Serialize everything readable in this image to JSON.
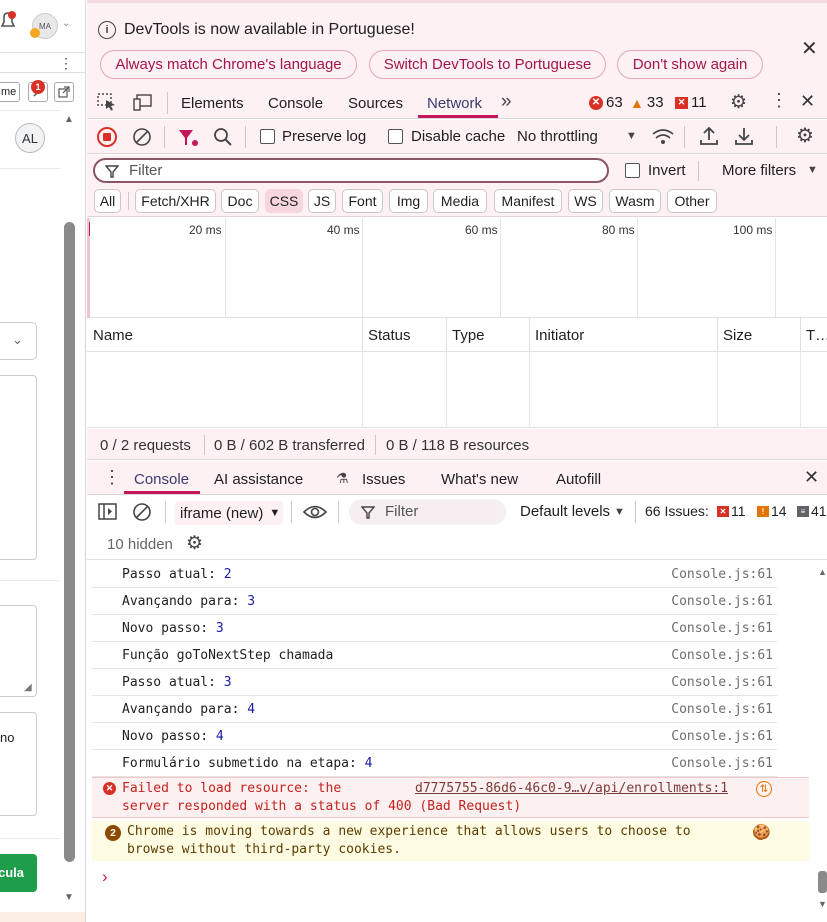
{
  "page_strip": {
    "avatar_initials": "MA",
    "notification_badge": "1",
    "user_initials": "AL",
    "tag_label": "me",
    "cut_text": "no",
    "action_button_label": "cula"
  },
  "infobar": {
    "message": "DevTools is now available in Portuguese!",
    "buttons": [
      "Always match Chrome's language",
      "Switch DevTools to Portuguese",
      "Don't show again"
    ]
  },
  "tabs": {
    "items": [
      "Elements",
      "Console",
      "Sources",
      "Network"
    ],
    "active": "Network",
    "errors": "63",
    "warnings": "33",
    "issues": "11"
  },
  "network_toolbar": {
    "preserve_log": "Preserve log",
    "disable_cache": "Disable cache",
    "throttling": "No throttling"
  },
  "filter_bar": {
    "placeholder": "Filter",
    "invert": "Invert",
    "more_filters": "More filters"
  },
  "type_filters": [
    "All",
    "Fetch/XHR",
    "Doc",
    "CSS",
    "JS",
    "Font",
    "Img",
    "Media",
    "Manifest",
    "WS",
    "Wasm",
    "Other"
  ],
  "active_type_filter": "CSS",
  "timeline": {
    "ticks": [
      "20 ms",
      "40 ms",
      "60 ms",
      "80 ms",
      "100 ms"
    ]
  },
  "table": {
    "columns": [
      "Name",
      "Status",
      "Type",
      "Initiator",
      "Size",
      "T…"
    ]
  },
  "summary": {
    "requests": "0 / 2 requests",
    "transferred": "0 B / 602 B transferred",
    "resources": "0 B / 118 B resources"
  },
  "drawer": {
    "tabs": [
      "Console",
      "AI assistance",
      "Issues",
      "What's new",
      "Autofill"
    ],
    "active": "Console"
  },
  "console_toolbar": {
    "context": "iframe (new)",
    "filter_placeholder": "Filter",
    "levels": "Default levels",
    "issues_label": "66 Issues:",
    "issue_errors": "11",
    "issue_warnings": "14",
    "issue_info": "41",
    "hidden": "10 hidden"
  },
  "console_messages": [
    {
      "text": "Passo atual: ",
      "num": "2",
      "source": "Console.js:61"
    },
    {
      "text": "Avançando para: ",
      "num": "3",
      "source": "Console.js:61"
    },
    {
      "text": "Novo passo: ",
      "num": "3",
      "source": "Console.js:61"
    },
    {
      "text": "Função goToNextStep chamada",
      "num": "",
      "source": "Console.js:61"
    },
    {
      "text": "Passo atual: ",
      "num": "3",
      "source": "Console.js:61"
    },
    {
      "text": "Avançando para: ",
      "num": "4",
      "source": "Console.js:61"
    },
    {
      "text": "Novo passo: ",
      "num": "4",
      "source": "Console.js:61"
    },
    {
      "text": "Formulário submetido na etapa: ",
      "num": "4",
      "source": "Console.js:61"
    }
  ],
  "error_message": {
    "line1": "Failed to load resource: the",
    "line2": "server responded with a status of 400 (Bad Request)",
    "link": "d7775755-86d6-46c0-9…v/api/enrollments:1"
  },
  "warning_message": {
    "count": "2",
    "line1": "Chrome is moving towards a new experience that allows users to choose to",
    "line2": "browse without third-party cookies."
  },
  "prompt": "›",
  "colors": {
    "accent": "#a3154a",
    "active_tab": "#c2185b",
    "error": "#d93025",
    "warning": "#e37400",
    "warning_bg": "#fefbe3",
    "error_bg": "#fdf0f0"
  }
}
